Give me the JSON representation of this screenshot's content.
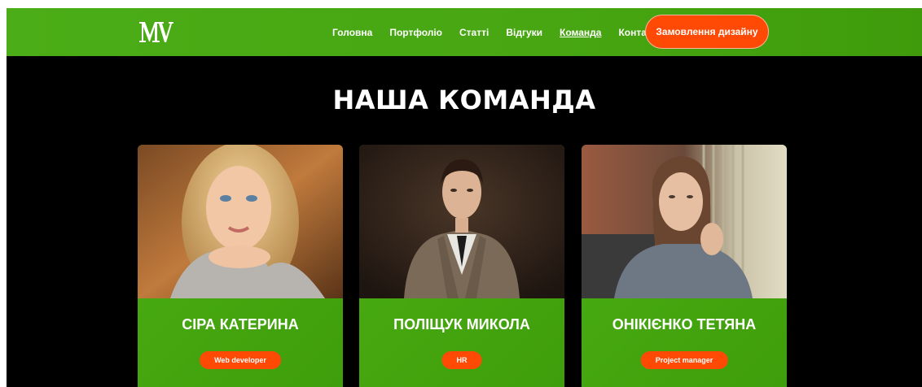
{
  "header": {
    "logo_text": "MV",
    "nav": [
      {
        "label": "Головна"
      },
      {
        "label": "Портфоліо"
      },
      {
        "label": "Статті"
      },
      {
        "label": "Відгуки"
      },
      {
        "label": "Команда",
        "active": true
      },
      {
        "label": "Контакти"
      }
    ],
    "cta_label": "Замовлення дизайну"
  },
  "colors": {
    "header_green": "#47a612",
    "accent_orange": "#ff4a06",
    "background": "#000000"
  },
  "team": {
    "title": "НАША КОМАНДА",
    "members": [
      {
        "name": "СІРА КАТЕРИНА",
        "role": "Web developer",
        "photo": "portrait-blonde-woman"
      },
      {
        "name": "ПОЛІЩУК МИКОЛА",
        "role": "HR",
        "photo": "portrait-man-in-suit"
      },
      {
        "name": "ОНІКІЄНКО ТЕТЯНА",
        "role": "Project manager",
        "photo": "portrait-woman-in-sweater"
      }
    ]
  }
}
